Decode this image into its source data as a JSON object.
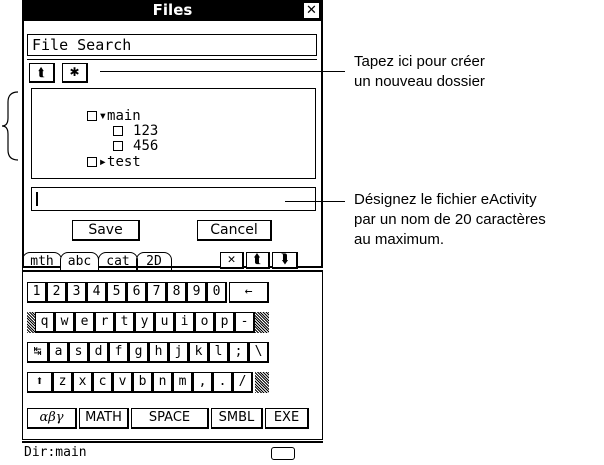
{
  "window": {
    "title": "Files",
    "close_glyph": "✕"
  },
  "menu": {
    "label": "File Search"
  },
  "toolbar": {
    "up_icon_glyph": "⮬",
    "new_folder_glyph": "✱"
  },
  "tree": [
    {
      "type": "folder",
      "expanded": true,
      "label": "main",
      "indent": 0
    },
    {
      "type": "file",
      "label": "123",
      "indent": 1
    },
    {
      "type": "file",
      "label": "456",
      "indent": 1
    },
    {
      "type": "folder",
      "expanded": false,
      "label": "test",
      "indent": 0
    }
  ],
  "filename_input": {
    "value": ""
  },
  "buttons": {
    "save": "Save",
    "cancel": "Cancel"
  },
  "keyboard": {
    "tabs": [
      "mth",
      "abc",
      "cat",
      "2D"
    ],
    "tab_icons": [
      "✕",
      "⮬",
      "⮯"
    ],
    "active_tab": "abc",
    "rows": [
      [
        "1",
        "2",
        "3",
        "4",
        "5",
        "6",
        "7",
        "8",
        "9",
        "0",
        "←"
      ],
      [
        "q",
        "w",
        "e",
        "r",
        "t",
        "y",
        "u",
        "i",
        "o",
        "p",
        "-"
      ],
      [
        "↹",
        "a",
        "s",
        "d",
        "f",
        "g",
        "h",
        "j",
        "k",
        "l",
        ";",
        "\\"
      ],
      [
        "⬆",
        "z",
        "x",
        "c",
        "v",
        "b",
        "n",
        "m",
        ",",
        ".",
        "/"
      ]
    ],
    "bottom": [
      "αβγ",
      "MATH",
      "SPACE",
      "SMBL",
      "EXE"
    ]
  },
  "status": {
    "dir": "Dir:main"
  },
  "callouts": {
    "new_folder": [
      "Tapez ici pour créer",
      "un nouveau dossier"
    ],
    "filename": [
      "Désignez le fichier eActivity",
      "par un nom de 20 caractères",
      "au maximum."
    ]
  }
}
